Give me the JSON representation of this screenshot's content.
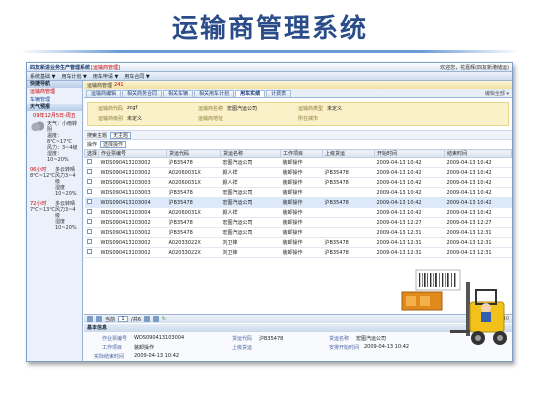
{
  "slide": {
    "title": "运输商管理系统"
  },
  "window": {
    "title": "四友新进业务生产管理系统",
    "subtitle": "[运输商管理]",
    "welcome": "欢迎您，花嘉辉(四友新港储运)"
  },
  "menu": [
    "系统基础 ▼",
    "用车计划 ▼",
    "用车申请 ▼",
    "用车合同 ▼"
  ],
  "sidebar": {
    "header": "快捷导航",
    "items": [
      "运输商管理",
      "车辆管理"
    ],
    "weather_header": "天气预报",
    "date": "09年12月5日-周五",
    "today": [
      "天气：小雨转阴",
      "温度：8℃~17℃",
      "风力：3~4级",
      "湿度：10~20%"
    ],
    "day2": {
      "label": "06小时",
      "temp": "8℃~12℃",
      "desc": "多云转晴",
      "wind": "风力3~4级",
      "humid": "湿度10~20%"
    },
    "day3": {
      "label": "72小时",
      "temp": "7℃~13℃",
      "desc": "多云转晴",
      "wind": "风力3~4级",
      "humid": "湿度10~20%"
    }
  },
  "breadcrumb": {
    "label": "运输商管理",
    "count": "241"
  },
  "tabs": [
    "运输商编辑",
    "相关商务合同",
    "相关车辆",
    "相关用车计划",
    "用车实绩",
    "计费表"
  ],
  "active_tab": 4,
  "tabs_right": "编辑全部 ▾",
  "info": {
    "code_label": "运输商代码",
    "code_value": "zcgf",
    "name_label": "运输商名称",
    "name_value": "宏图汽运公司",
    "type_label": "运输商类型",
    "type_value": "未定义",
    "level_label": "运输商级别",
    "level_value": "未定义",
    "addr_label": "运输商地址",
    "addr_value": "",
    "city_label": "所在城市",
    "city_value": ""
  },
  "search": {
    "label": "搜索主题",
    "value": "无主题"
  },
  "toolbar": {
    "label": "操作",
    "value": "选择操作"
  },
  "table": {
    "columns": [
      "选择",
      "作业票编号",
      "货运代码",
      "货运名称",
      "工作项目",
      "上级货运",
      "开始时间",
      "结束时间"
    ],
    "rows": [
      [
        "WDS090413103002",
        "沪B35478",
        "宏图汽运公司",
        "装卸操作",
        "",
        "2009-04-13 10:42",
        "2009-04-13 10:42"
      ],
      [
        "WDS090413103002",
        "A02060031X",
        "颜人祥",
        "装卸操作",
        "沪B35478",
        "2009-04-13 10:42",
        "2009-04-13 10:42"
      ],
      [
        "WDS090413103003",
        "A02060031X",
        "颜人祥",
        "装卸操作",
        "沪B35478",
        "2009-04-13 10:42",
        "2009-04-13 10:42"
      ],
      [
        "WDS090413103003",
        "沪B35478",
        "宏图汽运公司",
        "装卸操作",
        "",
        "2009-04-13 10:42",
        "2009-04-13 10:42"
      ],
      [
        "WDS090413103004",
        "沪B35478",
        "宏图汽运公司",
        "装卸操作",
        "沪B35478",
        "2009-04-13 10:42",
        "2009-04-13 10:42"
      ],
      [
        "WDS090413103004",
        "A02060031X",
        "颜人祥",
        "装卸操作",
        "",
        "2009-04-13 10:42",
        "2009-04-13 10:42"
      ],
      [
        "WDS090413103002",
        "沪B35478",
        "宏图汽运公司",
        "装卸操作",
        "",
        "2009-04-13 12:27",
        "2009-04-13 12:27"
      ],
      [
        "WDS090413103002",
        "沪B35478",
        "宏图汽运公司",
        "装卸操作",
        "",
        "2009-04-13 12:31",
        "2009-04-13 12:31"
      ],
      [
        "WDS090413103002",
        "A02033022X",
        "刘卫锋",
        "装卸操作",
        "沪B35478",
        "2009-04-13 12:31",
        "2009-04-13 12:31"
      ],
      [
        "WDS090413103002",
        "A02033022X",
        "刘卫锋",
        "装卸操作",
        "沪B35478",
        "2009-04-13 12:31",
        "2009-04-13 12:31"
      ]
    ],
    "selected_row": 4
  },
  "pager": {
    "prefix": "当前",
    "page": "1",
    "suffix": "/共6",
    "right": "1 - 10 of 40"
  },
  "basic": {
    "header": "基本信息",
    "job_no_label": "作业票编号",
    "job_no_value": "WDS090413103004",
    "code_label": "货运代码",
    "code_value": "沪B35478",
    "carrier_label": "货运名称",
    "carrier_value": "宏图汽运公司",
    "work_label": "工作项目",
    "work_value": "装卸操作",
    "parent_label": "上级货运",
    "parent_value": "",
    "plan_start_label": "安排开始时间",
    "plan_start_value": "2009-04-13 10:42",
    "actual_start_label": "实际结束时间",
    "actual_start_value": "2009-04-13 10:42"
  },
  "colors": {
    "title": "#2a4d8a",
    "accent": "#c00000",
    "header": "#b9cde8"
  }
}
